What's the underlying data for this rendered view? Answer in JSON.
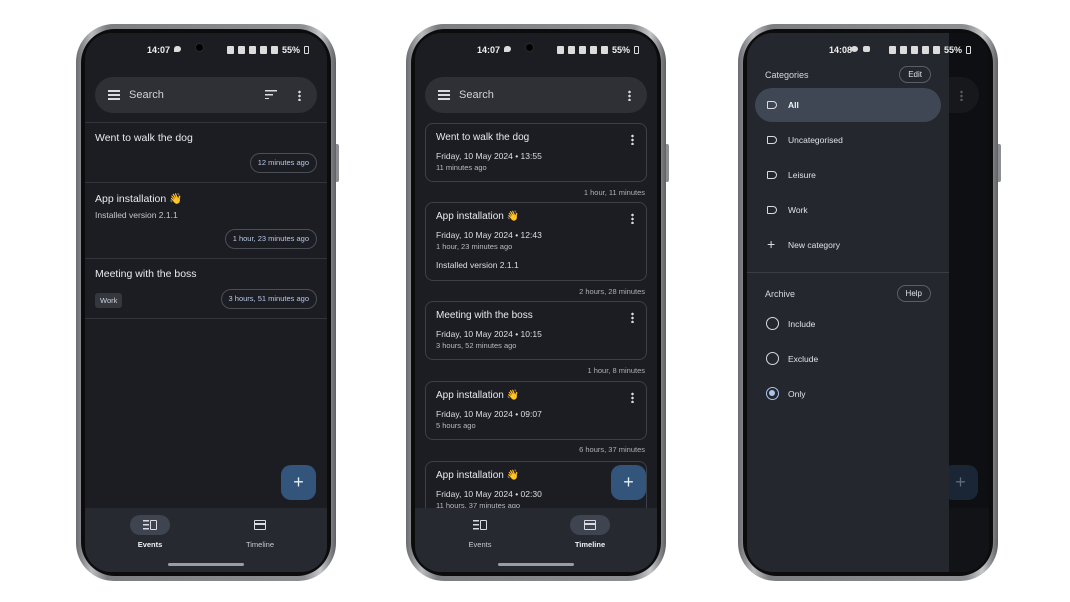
{
  "status_bar": {
    "left_phone": {
      "time": "14:07",
      "battery": "55%"
    },
    "middle_phone": {
      "time": "14:07",
      "battery": "55%"
    },
    "right_phone": {
      "time": "14:08",
      "battery": "55%"
    }
  },
  "search": {
    "placeholder": "Search"
  },
  "events_screen": {
    "items": [
      {
        "title": "Went to walk the dog",
        "note": "",
        "tag": "",
        "ago": "12 minutes ago"
      },
      {
        "title": "App installation 👋",
        "note": "Installed version 2.1.1",
        "tag": "",
        "ago": "1 hour, 23 minutes ago"
      },
      {
        "title": "Meeting with the boss",
        "note": "",
        "tag": "Work",
        "ago": "3 hours, 51 minutes ago"
      }
    ]
  },
  "timeline_screen": {
    "cards": [
      {
        "title": "Went to walk the dog",
        "date": "Friday, 10 May 2024 • 13:55",
        "ago": "11 minutes ago",
        "note": "",
        "gap_after": "1 hour, 11 minutes"
      },
      {
        "title": "App installation 👋",
        "date": "Friday, 10 May 2024 • 12:43",
        "ago": "1 hour, 23 minutes ago",
        "note": "Installed version 2.1.1",
        "gap_after": "2 hours, 28 minutes"
      },
      {
        "title": "Meeting with the boss",
        "date": "Friday, 10 May 2024 • 10:15",
        "ago": "3 hours, 52 minutes ago",
        "note": "",
        "gap_after": "1 hour, 8 minutes"
      },
      {
        "title": "App installation 👋",
        "date": "Friday, 10 May 2024 • 09:07",
        "ago": "5 hours ago",
        "note": "",
        "gap_after": "6 hours, 37 minutes"
      },
      {
        "title": "App installation 👋",
        "date": "Friday, 10 May 2024 • 02:30",
        "ago": "11 hours, 37 minutes ago",
        "note": "",
        "gap_after": ""
      }
    ]
  },
  "fab": {
    "icon": "plus-icon",
    "glyph": "+"
  },
  "bottom_nav": {
    "items": [
      {
        "label": "Events",
        "icon": "events-icon"
      },
      {
        "label": "Timeline",
        "icon": "timeline-icon"
      }
    ]
  },
  "drawer": {
    "categories_title": "Categories",
    "edit_label": "Edit",
    "categories": [
      {
        "label": "All",
        "selected": true
      },
      {
        "label": "Uncategorised",
        "selected": false
      },
      {
        "label": "Leisure",
        "selected": false
      },
      {
        "label": "Work",
        "selected": false
      }
    ],
    "new_category_label": "New category",
    "archive_title": "Archive",
    "help_label": "Help",
    "archive_options": [
      {
        "label": "Include",
        "selected": false
      },
      {
        "label": "Exclude",
        "selected": false
      },
      {
        "label": "Only",
        "selected": true
      }
    ]
  },
  "colors": {
    "background": "#1b1d22",
    "accent": "#33557c",
    "selected": "#3f4654"
  }
}
